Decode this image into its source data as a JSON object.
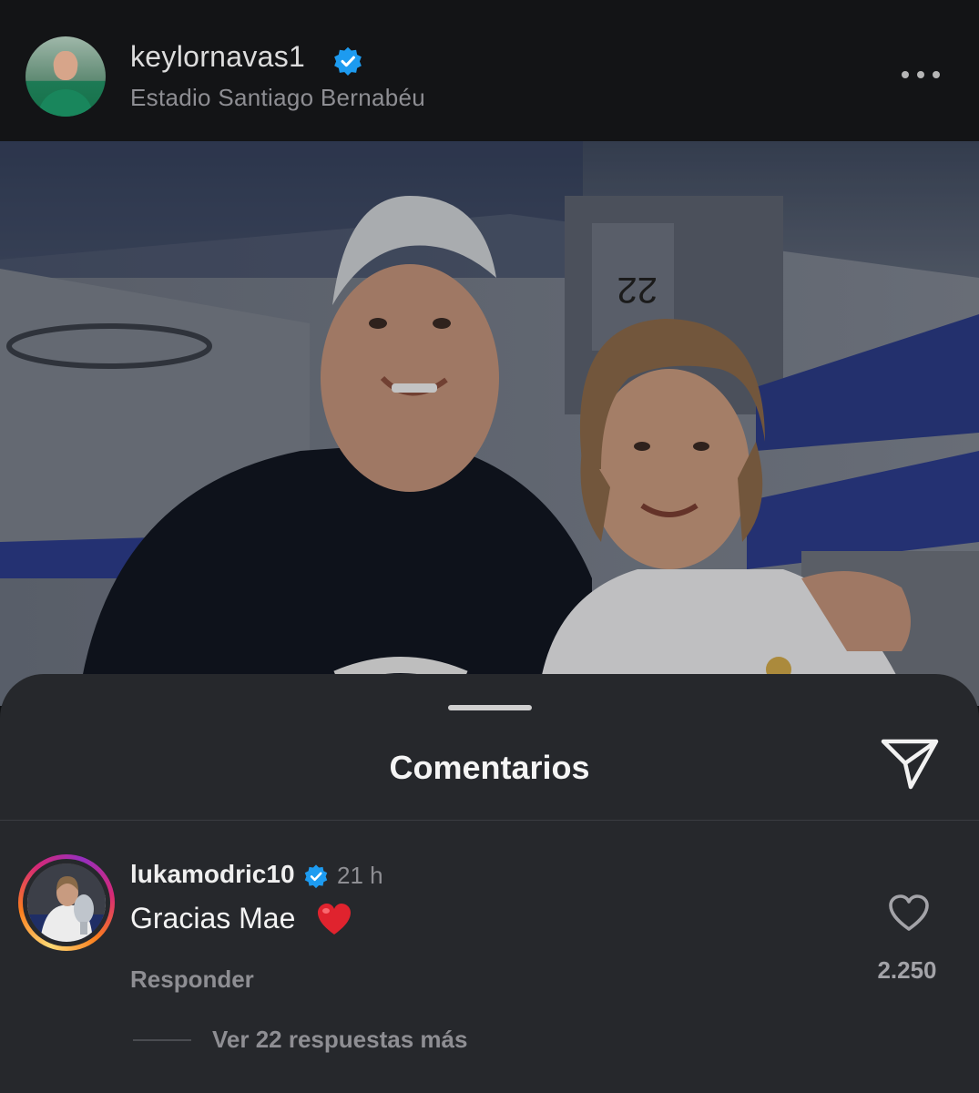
{
  "post": {
    "username": "keylornavas1",
    "location": "Estadio Santiago Bernabéu",
    "more_icon": "more-horizontal-icon"
  },
  "comments_sheet": {
    "title": "Comentarios",
    "share_icon": "send-icon"
  },
  "comment": {
    "username": "lukamodric10",
    "time": "21 h",
    "text": "Gracias Mae",
    "emoji": "red-heart-emoji",
    "reply_label": "Responder",
    "likes": "2.250",
    "view_replies": "Ver 22 respuestas más"
  },
  "colors": {
    "background": "#131416",
    "sheet": "#26282c",
    "verified": "#1d9bf0",
    "muted_text": "#8e8e93"
  }
}
